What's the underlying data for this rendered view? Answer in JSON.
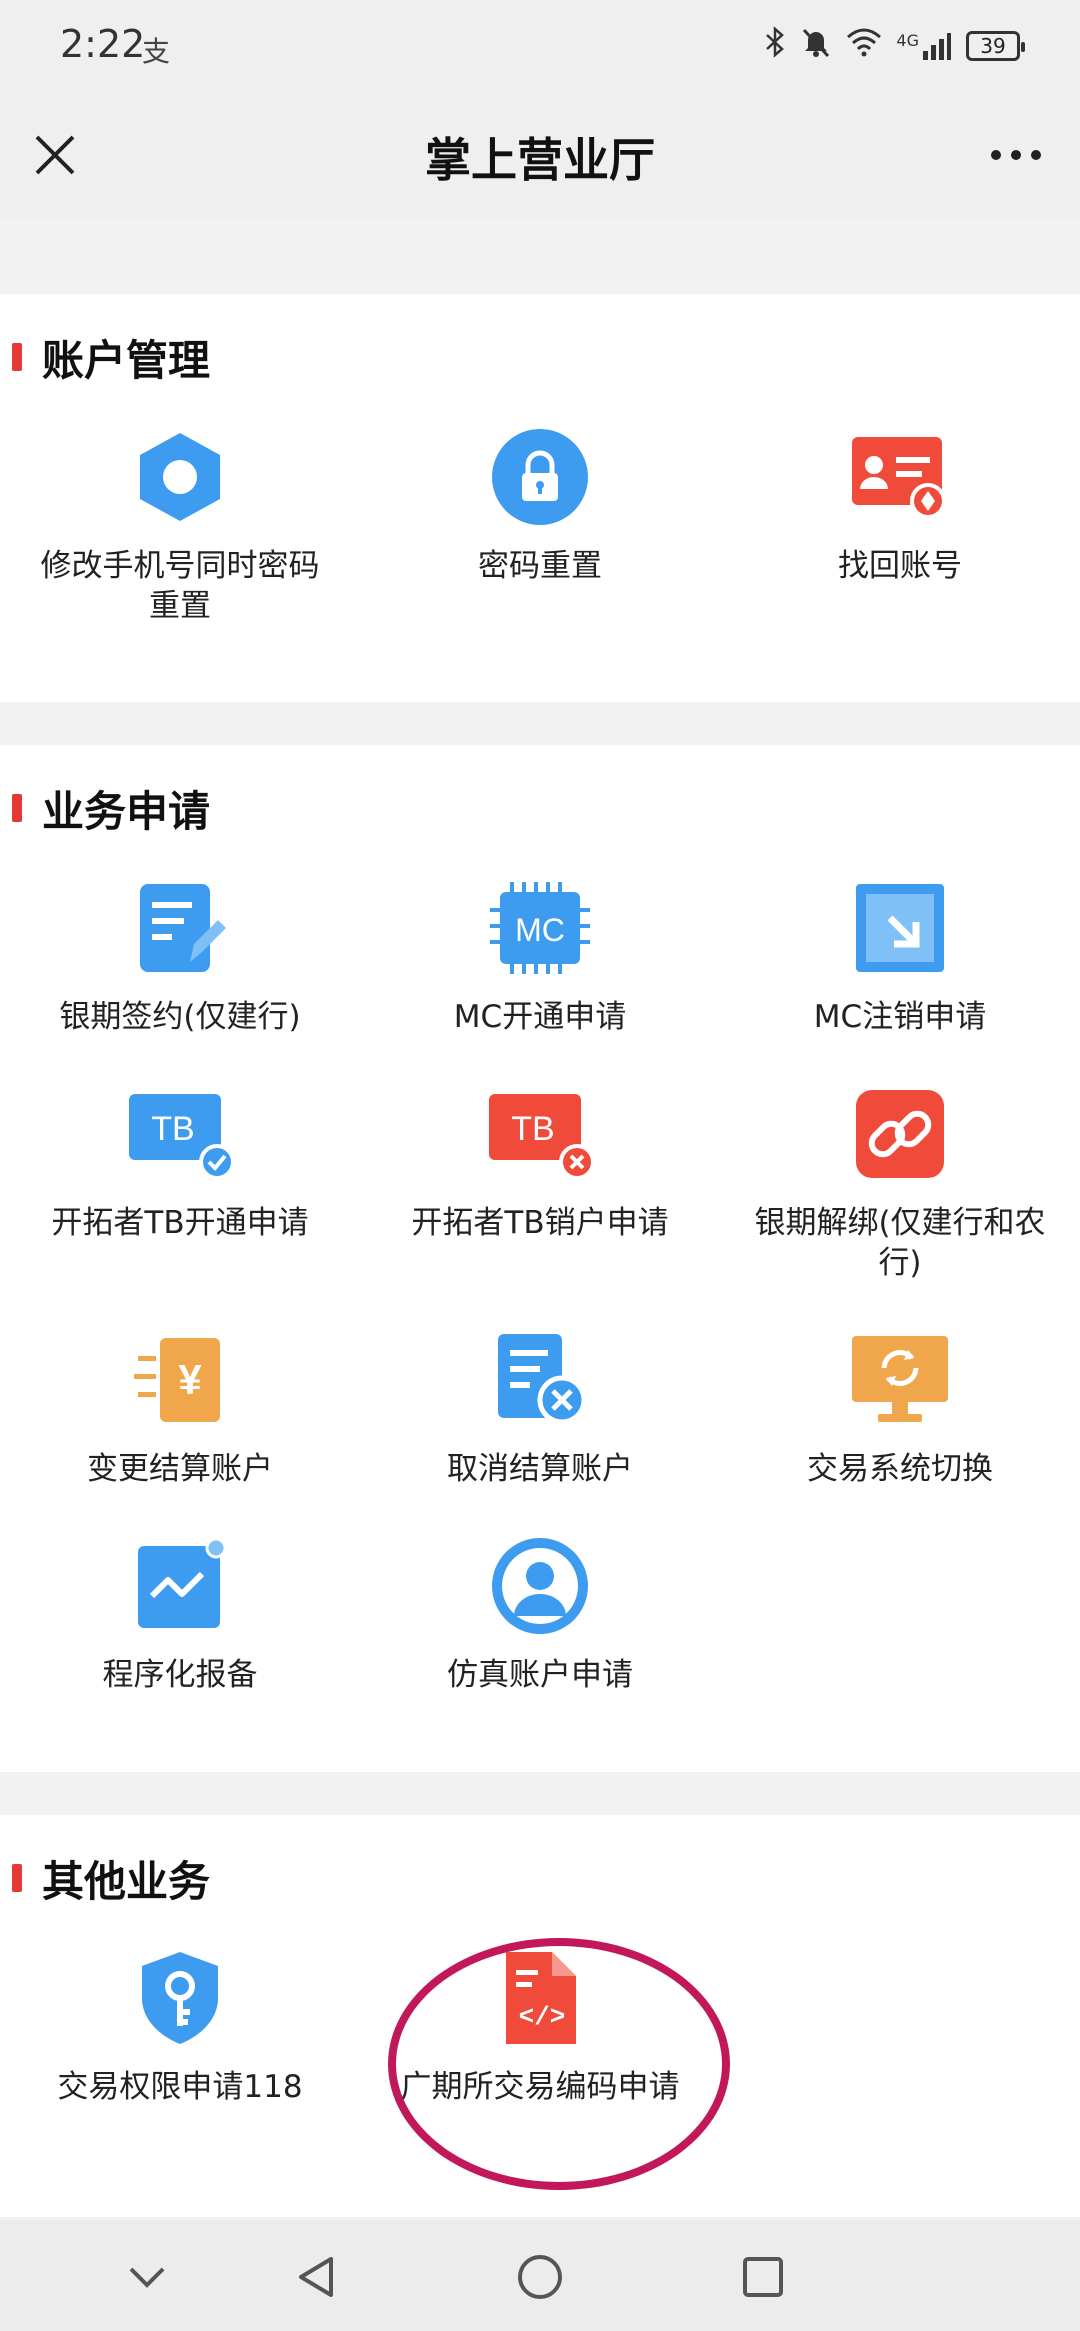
{
  "status": {
    "time": "2:22",
    "pay_glyph": "支",
    "network": "4G",
    "battery": "39"
  },
  "header": {
    "title": "掌上营业厅",
    "close_glyph": "×",
    "more_glyph": "•••"
  },
  "sections": [
    {
      "title": "账户管理",
      "items": [
        {
          "label": "修改手机号同时密码重置",
          "icon": "hexagon-icon"
        },
        {
          "label": "密码重置",
          "icon": "lock-icon"
        },
        {
          "label": "找回账号",
          "icon": "id-card-icon"
        }
      ]
    },
    {
      "title": "业务申请",
      "items": [
        {
          "label": "银期签约(仅建行)",
          "icon": "document-pen-icon"
        },
        {
          "label": "MC开通申请",
          "icon": "chip-icon",
          "icon_text": "MC"
        },
        {
          "label": "MC注销申请",
          "icon": "arrow-box-icon"
        },
        {
          "label": "开拓者TB开通申请",
          "icon": "tb-check-icon",
          "icon_text": "TB"
        },
        {
          "label": "开拓者TB销户申请",
          "icon": "tb-close-icon",
          "icon_text": "TB"
        },
        {
          "label": "银期解绑(仅建行和农行)",
          "icon": "link-icon"
        },
        {
          "label": "变更结算账户",
          "icon": "yen-icon",
          "icon_text": "¥"
        },
        {
          "label": "取消结算账户",
          "icon": "document-close-icon"
        },
        {
          "label": "交易系统切换",
          "icon": "monitor-refresh-icon"
        },
        {
          "label": "程序化报备",
          "icon": "wave-chart-icon"
        },
        {
          "label": "仿真账户申请",
          "icon": "user-circle-icon"
        }
      ]
    },
    {
      "title": "其他业务",
      "items": [
        {
          "label": "交易权限申请118",
          "icon": "shield-key-icon"
        },
        {
          "label": "广期所交易编码申请",
          "icon": "code-file-icon",
          "icon_text": "</>"
        }
      ]
    }
  ],
  "colors": {
    "blue": "#3d9cf0",
    "red": "#f04b3a",
    "orange": "#f0a64a",
    "accent_bar": "#e53935",
    "annotation": "#c2185b"
  }
}
